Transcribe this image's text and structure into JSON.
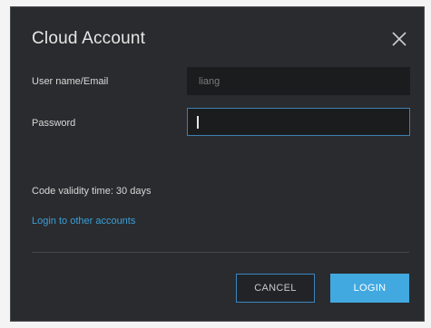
{
  "dialog": {
    "title": "Cloud Account",
    "close_icon": "close-icon"
  },
  "form": {
    "username_label": "User name/Email",
    "username_value": "liang",
    "password_label": "Password",
    "password_value": ""
  },
  "info": {
    "validity_text": "Code validity time: 30 days",
    "other_accounts_link": "Login to other accounts"
  },
  "buttons": {
    "cancel_label": "CANCEL",
    "login_label": "LOGIN"
  },
  "colors": {
    "dialog_bg": "#2a2b2e",
    "accent": "#42a8e0",
    "link": "#3a9fd8",
    "focus_border": "#3d7fb0"
  }
}
